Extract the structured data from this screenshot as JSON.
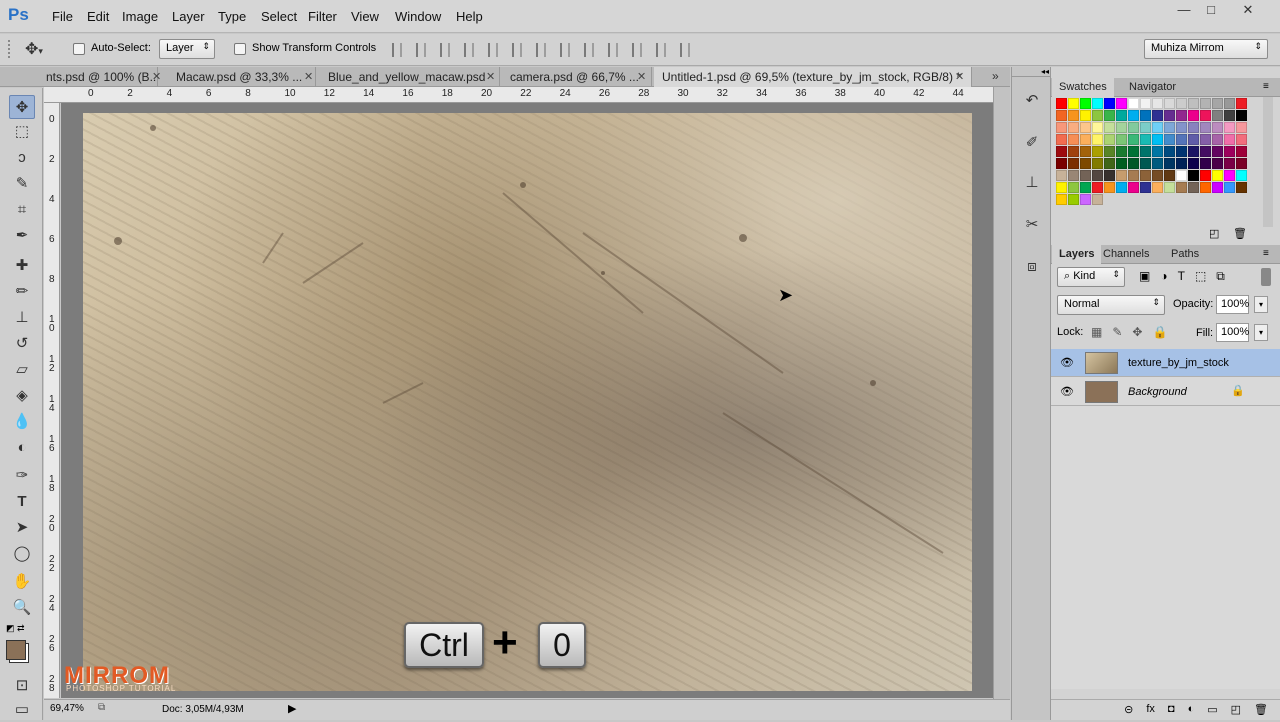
{
  "app": {
    "logo": "Ps"
  },
  "menu": [
    "File",
    "Edit",
    "Image",
    "Layer",
    "Type",
    "Select",
    "Filter",
    "View",
    "Window",
    "Help"
  ],
  "window_controls": {
    "minimize": "—",
    "maximize": "□",
    "close": "✕"
  },
  "options": {
    "auto_select_label": "Auto-Select:",
    "auto_select_value": "Layer",
    "transform_label": "Show Transform Controls",
    "workspace": "Muhiza Mirrom"
  },
  "tabs": [
    {
      "label": "nts.psd @ 100% (B..."
    },
    {
      "label": "Macaw.psd @ 33,3% ..."
    },
    {
      "label": "Blue_and_yellow_macaw.psd"
    },
    {
      "label": "camera.psd @ 66,7% ..."
    },
    {
      "label": "Untitled-1.psd @ 69,5% (texture_by_jm_stock, RGB/8) *"
    }
  ],
  "ruler": {
    "h": [
      "0",
      "2",
      "4",
      "6",
      "8",
      "10",
      "12",
      "14",
      "16",
      "18",
      "20",
      "22",
      "24",
      "26",
      "28",
      "30",
      "32",
      "34",
      "36",
      "38",
      "40",
      "42",
      "44"
    ],
    "v": [
      "0",
      "2",
      "4",
      "6",
      "8",
      "1\n0",
      "1\n2",
      "1\n4",
      "1\n6",
      "1\n8",
      "2\n0",
      "2\n2",
      "2\n4",
      "2\n6",
      "2\n8"
    ]
  },
  "overlay": {
    "key1": "Ctrl",
    "plus": "+",
    "key2": "0"
  },
  "watermark": {
    "title": "MIRROM",
    "subtitle": "PHOTOSHOP TUTORIAL"
  },
  "status": {
    "zoom": "69,47%",
    "doc": "Doc: 3,05M/4,93M"
  },
  "swatches_panel": {
    "tabs": [
      "Swatches",
      "Navigator"
    ]
  },
  "layers_panel": {
    "tabs": [
      "Layers",
      "Channels",
      "Paths"
    ],
    "kind": "Kind",
    "blend": "Normal",
    "opacity_label": "Opacity:",
    "opacity": "100%",
    "lock_label": "Lock:",
    "fill_label": "Fill:",
    "fill": "100%",
    "layers": [
      {
        "name": "texture_by_jm_stock"
      },
      {
        "name": "Background"
      }
    ]
  },
  "colors": {
    "accent": "#2a72c7",
    "selected_layer": "#a6c1e6",
    "watermark": "#e25a24",
    "foreground": "#8b7158",
    "background": "#ffffff"
  }
}
